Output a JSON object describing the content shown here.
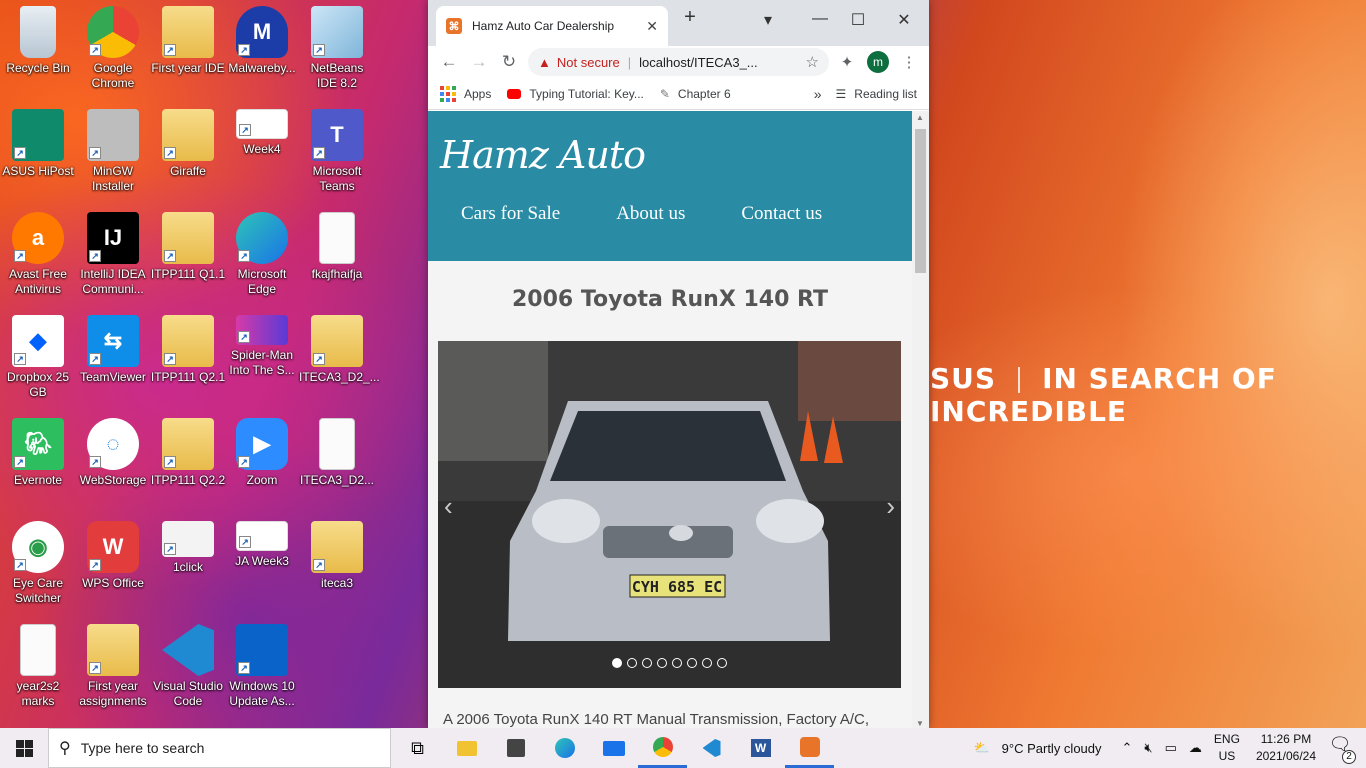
{
  "desktop": {
    "icons": [
      {
        "label": "Recycle Bin",
        "icon": "recycle-bin-icon"
      },
      {
        "label": "Google Chrome",
        "icon": "chrome-icon"
      },
      {
        "label": "First year IDE",
        "icon": "folder-icon"
      },
      {
        "label": "Malwareby...",
        "icon": "malwarebytes-icon"
      },
      {
        "label": "NetBeans IDE 8.2",
        "icon": "netbeans-icon"
      },
      {
        "label": "ASUS HiPost",
        "icon": "asus-hipost-icon"
      },
      {
        "label": "MinGW Installer",
        "icon": "mingw-icon"
      },
      {
        "label": "Giraffe",
        "icon": "folder-icon"
      },
      {
        "label": "Week4",
        "icon": "powerpoint-file-icon"
      },
      {
        "label": "Microsoft Teams",
        "icon": "teams-icon"
      },
      {
        "label": "Avast Free Antivirus",
        "icon": "avast-icon"
      },
      {
        "label": "IntelliJ IDEA Communi...",
        "icon": "intellij-icon"
      },
      {
        "label": "ITPP111 Q1.1",
        "icon": "folder-icon"
      },
      {
        "label": "Microsoft Edge",
        "icon": "edge-icon"
      },
      {
        "label": "fkajfhaifja",
        "icon": "text-file-icon"
      },
      {
        "label": "Dropbox 25 GB",
        "icon": "dropbox-icon"
      },
      {
        "label": "TeamViewer",
        "icon": "teamviewer-icon"
      },
      {
        "label": "ITPP111 Q2.1",
        "icon": "folder-icon"
      },
      {
        "label": "Spider-Man Into The S...",
        "icon": "video-file-icon"
      },
      {
        "label": "ITECA3_D2_...",
        "icon": "folder-icon"
      },
      {
        "label": "Evernote",
        "icon": "evernote-icon"
      },
      {
        "label": "WebStorage",
        "icon": "webstorage-icon"
      },
      {
        "label": "ITPP111 Q2.2",
        "icon": "folder-icon"
      },
      {
        "label": "Zoom",
        "icon": "zoom-icon"
      },
      {
        "label": "ITECA3_D2...",
        "icon": "text-file-icon"
      },
      {
        "label": "Eye Care Switcher",
        "icon": "eye-care-icon"
      },
      {
        "label": "WPS Office",
        "icon": "wps-icon"
      },
      {
        "label": "1click",
        "icon": "settings-file-icon"
      },
      {
        "label": "JA Week3",
        "icon": "powerpoint-file-icon"
      },
      {
        "label": "iteca3",
        "icon": "folder-icon"
      },
      {
        "label": "year2s2 marks",
        "icon": "text-file-icon"
      },
      {
        "label": "First year assignments",
        "icon": "folder-icon"
      },
      {
        "label": "Visual Studio Code",
        "icon": "vscode-icon"
      },
      {
        "label": "Windows 10 Update As...",
        "icon": "windows-update-icon"
      }
    ],
    "wallpaper_text": "IN SEARCH OF INCREDIBLE",
    "wallpaper_logo": "SUS"
  },
  "browser": {
    "tab_title": "Hamz Auto Car Dealership",
    "security_label": "Not secure",
    "url": "localhost/ITECA3_...",
    "profile_initial": "m",
    "bookmarks": [
      {
        "label": "Apps",
        "icon": "apps-grid-icon"
      },
      {
        "label": "Typing Tutorial: Key...",
        "icon": "youtube-icon"
      },
      {
        "label": "Chapter 6",
        "icon": "chapter-icon"
      }
    ],
    "overflow_label": "»",
    "reading_list": "Reading list"
  },
  "site": {
    "brand": "Hamz Auto",
    "nav": [
      "Cars for Sale",
      "About us",
      "Contact us"
    ],
    "car_title": "2006 Toyota RunX 140 RT",
    "plate": "CYH 685 EC",
    "slides": 8,
    "active_slide": 0,
    "description": "A 2006 Toyota RunX 140 RT Manual Transmission, Factory A/C,"
  },
  "taskbar": {
    "search_placeholder": "Type here to search",
    "weather": "9°C  Partly cloudy",
    "lang_top": "ENG",
    "lang_bottom": "US",
    "time": "11:26 PM",
    "date": "2021/06/24",
    "notifications": "2"
  },
  "colors": {
    "site_header": "#2a8ca4",
    "accent": "#2a6cd6"
  }
}
